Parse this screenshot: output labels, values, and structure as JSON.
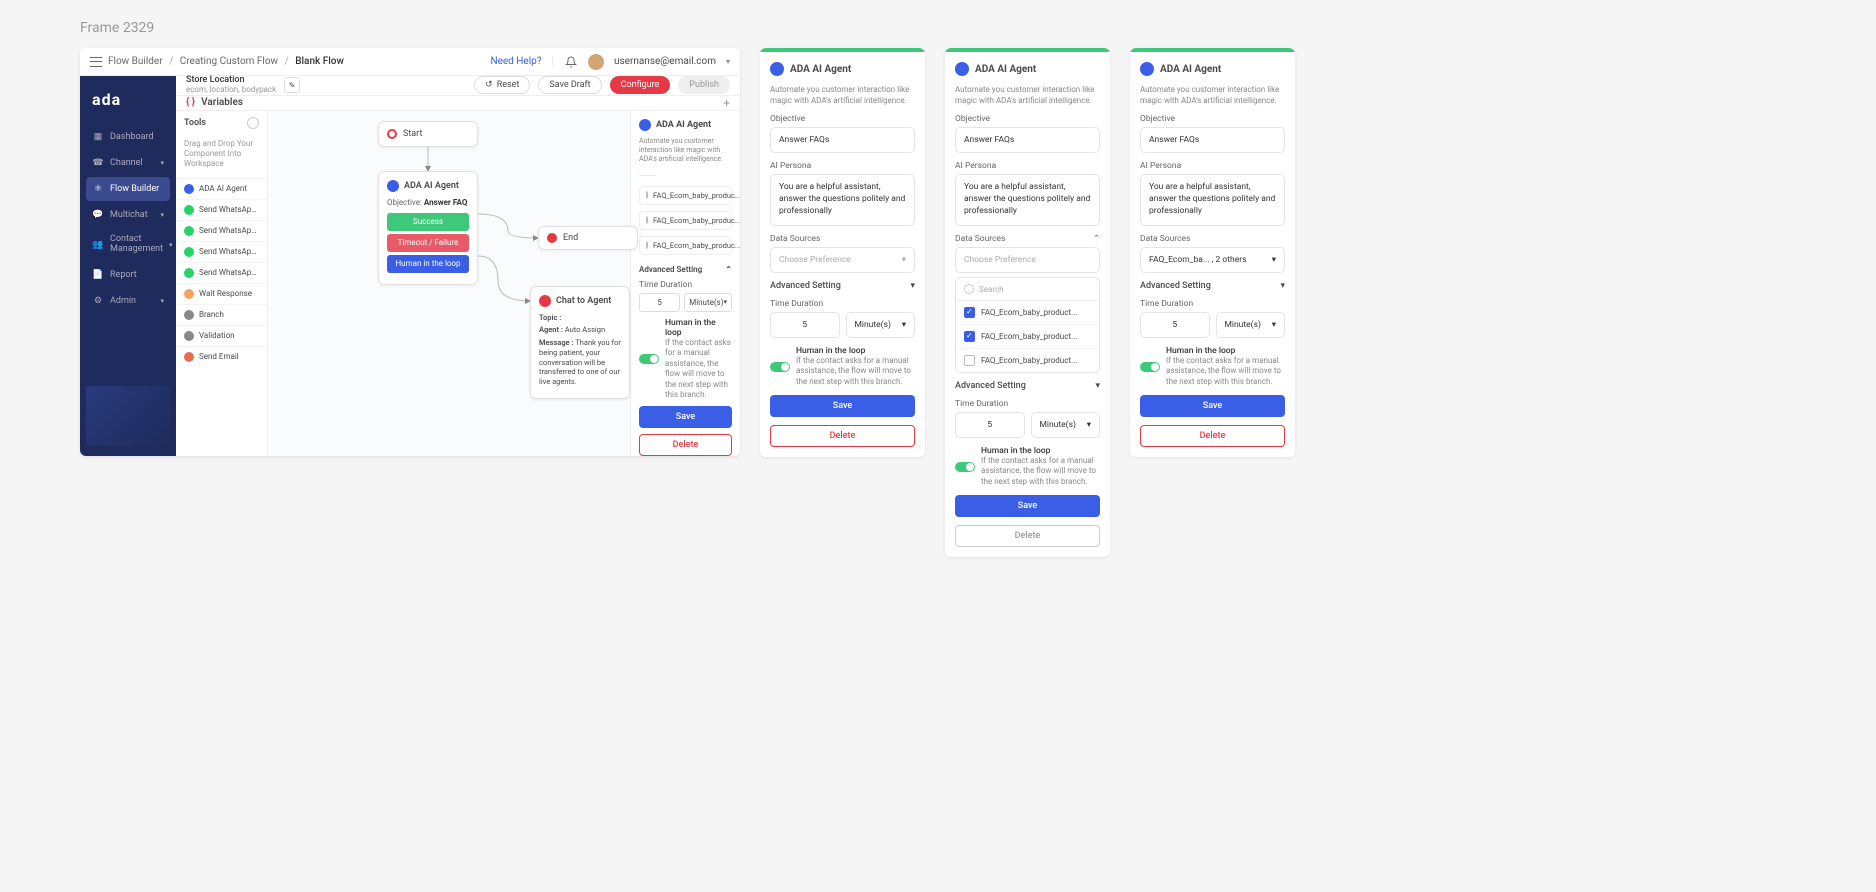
{
  "frame_label": "Frame 2329",
  "top_bar": {
    "breadcrumb": [
      "Flow Builder",
      "Creating Custom Flow",
      "Blank Flow"
    ],
    "help": "Need Help?",
    "user_email": "usernanse@email.com"
  },
  "sidebar": {
    "logo": "ada",
    "items": [
      {
        "label": "Dashboard",
        "icon": "grid"
      },
      {
        "label": "Channel",
        "icon": "phone",
        "expandable": true
      },
      {
        "label": "Flow Builder",
        "icon": "flow",
        "active": true
      },
      {
        "label": "Multichat",
        "icon": "chat",
        "expandable": true
      },
      {
        "label": "Contact Management",
        "icon": "contacts",
        "expandable": true
      },
      {
        "label": "Report",
        "icon": "report"
      },
      {
        "label": "Admin",
        "icon": "gear",
        "expandable": true
      }
    ]
  },
  "action_bar": {
    "store_name": "Store Location",
    "store_meta": "ecom, location, bodypack",
    "reset": "Reset",
    "save_draft": "Save Draft",
    "configure": "Configure",
    "publish": "Publish"
  },
  "variables_label": "Variables",
  "tools": {
    "title": "Tools",
    "hint": "Drag and Drop Your Component Into Workspace",
    "items": [
      {
        "label": "ADA AI Agent",
        "color": "#3a5ee6"
      },
      {
        "label": "Send WhatsApp Message",
        "color": "#25d366"
      },
      {
        "label": "Send WhatsApp List",
        "color": "#25d366"
      },
      {
        "label": "Send WhatsApp Button",
        "color": "#25d366"
      },
      {
        "label": "Send WhatsApp Template",
        "color": "#25d366"
      },
      {
        "label": "Wait Response",
        "color": "#f4a261"
      },
      {
        "label": "Branch",
        "color": "#888"
      },
      {
        "label": "Validation",
        "color": "#888"
      },
      {
        "label": "Send Email",
        "color": "#e76f51"
      }
    ]
  },
  "flow": {
    "start": "Start",
    "end": "End",
    "ai_node": {
      "title": "ADA AI Agent",
      "objective_label": "Objective:",
      "objective_value": "Answer FAQ",
      "branches": [
        {
          "label": "Success",
          "color": "#3ec97a"
        },
        {
          "label": "Timeout / Failure",
          "color": "#e85a68"
        },
        {
          "label": "Human in the loop",
          "color": "#3a5ee6"
        }
      ]
    },
    "chat_node": {
      "title": "Chat to Agent",
      "rows": [
        {
          "label": "Topic :",
          "value": ""
        },
        {
          "label": "Agent :",
          "value": "Auto Assign"
        },
        {
          "label": "Message :",
          "value": "Thank you for being patient, your conversation will be transferred to one of our live agents."
        }
      ]
    }
  },
  "config": {
    "title": "ADA AI Agent",
    "sub": "Automate you customer interaction like magic with ADA's artificial intelligence.",
    "faq_chip": "FAQ_Ecom_baby_produc...",
    "advanced": "Advanced Setting",
    "time_label": "Time Duration",
    "time_value": "5",
    "time_unit": "Minute(s)",
    "hloop_title": "Human in the loop",
    "hloop_desc": "If the contact asks for a manual assistance, the flow will move to the next step with this branch.",
    "save": "Save",
    "delete": "Delete",
    "objective_label": "Objective",
    "objective_value": "Answer FAQs",
    "persona_label": "AI Persona",
    "persona_value": "You are a helpful assistant, answer the questions politely and professionally",
    "ds_label": "Data Sources",
    "ds_placeholder": "Choose Preference",
    "ds_search": "Search",
    "ds_options": [
      {
        "label": "FAQ_Ecom_baby_product...",
        "checked": true
      },
      {
        "label": "FAQ_Ecom_baby_product...",
        "checked": true
      },
      {
        "label": "FAQ_Ecom_baby_product...",
        "checked": false
      }
    ],
    "ds_selected_summary": "FAQ_Ecom_ba... , 2 others"
  }
}
